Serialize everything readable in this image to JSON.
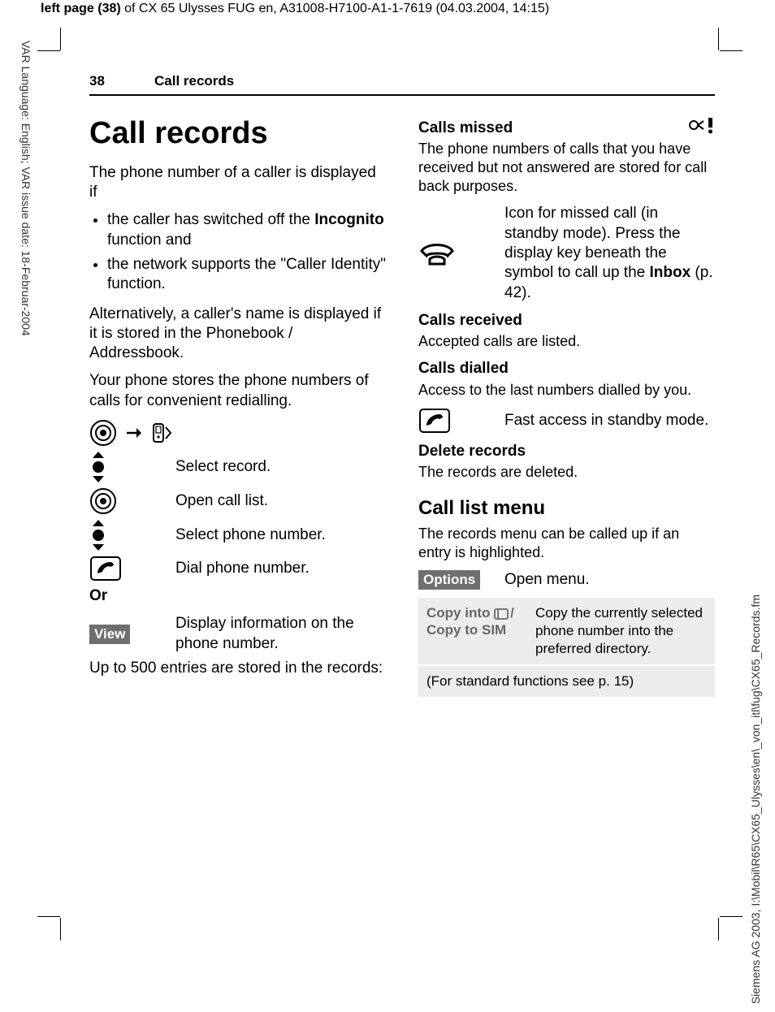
{
  "meta": {
    "top_header_prefix": "left page (38)",
    "top_header_rest": " of CX 65 Ulysses FUG en, A31008-H7100-A1-1-7619 (04.03.2004, 14:15)",
    "left_margin": "VAR Language: English; VAR issue date: 18-Februar-2004",
    "right_margin": "Siemens AG 2003, I:\\Mobil\\R65\\CX65_Ulysses\\en\\_von_itl\\fug\\CX65_Records.fm"
  },
  "header": {
    "page_number": "38",
    "section": "Call records"
  },
  "left": {
    "title": "Call records",
    "p1": "The phone number of a caller is displayed if",
    "b1_pre": "the caller has switched off the ",
    "b1_bold": "Incognito",
    "b1_post": " function and",
    "b2": "the network supports the \"Caller Identity\" function.",
    "p2": "Alternatively, a caller's name is displayed if it is stored in the Phonebook / Addressbook.",
    "p3": "Your phone stores the phone numbers of calls for convenient redialling.",
    "step1": "Select record.",
    "step2": "Open call list.",
    "step3": "Select phone number.",
    "step4": "Dial phone number.",
    "or": "Or",
    "view_label": "View",
    "view_desc": "Display information on the phone number.",
    "p4": "Up to 500 entries are stored in the records:"
  },
  "right": {
    "h_missed": "Calls missed",
    "p_missed": "The phone numbers of calls that you have received but not answered are stored for call back purposes.",
    "missed_icon_desc_pre": "Icon for missed call (in standby mode). Press the display key beneath the symbol to call up the ",
    "missed_icon_bold": "Inbox",
    "missed_icon_desc_post": " (p. 42).",
    "h_received": "Calls received",
    "p_received": "Accepted calls are listed.",
    "h_dialled": "Calls dialled",
    "p_dialled": "Access to the last numbers dialled by you.",
    "dial_icon_desc": "Fast access in standby mode.",
    "h_delete": "Delete records",
    "p_delete": "The records are deleted.",
    "h_menu": "Call list menu",
    "p_menu": "The records menu can be called up if an entry is highlighted.",
    "options_label": "Options",
    "options_desc": "Open menu.",
    "tbl_key1a": "Copy into ",
    "tbl_key1b": "Copy to SIM",
    "tbl_val1": "Copy the currently selected phone number into the preferred directory.",
    "tbl_footer": "(For standard functions see p. 15)"
  }
}
